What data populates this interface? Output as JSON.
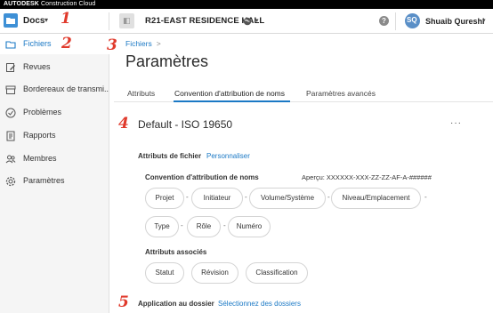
{
  "brand": {
    "bold": "AUTODESK",
    "rest": " Construction Cloud"
  },
  "header": {
    "app_label": "Docs",
    "project_name": "R21-EAST RESIDENCE HALL",
    "help": "?",
    "user_name": "Shuaib Qureshi",
    "user_initials": "SQ"
  },
  "sidebar": {
    "items": [
      {
        "label": "Fichiers",
        "icon": "folder-icon",
        "active": true
      },
      {
        "label": "Revues",
        "icon": "review-icon"
      },
      {
        "label": "Bordereaux de transmi...",
        "icon": "transmittal-icon"
      },
      {
        "label": "Problèmes",
        "icon": "issues-icon"
      },
      {
        "label": "Rapports",
        "icon": "reports-icon"
      },
      {
        "label": "Membres",
        "icon": "members-icon"
      },
      {
        "label": "Paramètres",
        "icon": "settings-icon"
      }
    ]
  },
  "breadcrumb": {
    "item": "Fichiers",
    "sep": ">"
  },
  "page_title": "Paramètres",
  "tabs": [
    {
      "label": "Attributs"
    },
    {
      "label": "Convention d'attribution de noms",
      "active": true
    },
    {
      "label": "Paramètres avancés"
    }
  ],
  "standard": {
    "title": "Default - ISO 19650",
    "more": "···"
  },
  "file_attributes": {
    "label": "Attributs de fichier",
    "link": "Personnaliser"
  },
  "naming": {
    "label": "Convention d'attribution de noms",
    "preview": "Aperçu: XXXXXX-XXX-ZZ-ZZ-AF-A-######",
    "row1": [
      "Projet",
      "Initiateur",
      "Volume/Système",
      "Niveau/Emplacement"
    ],
    "row2": [
      "Type",
      "Rôle",
      "Numéro"
    ],
    "dash": "-"
  },
  "associated": {
    "label": "Attributs associés",
    "items": [
      "Statut",
      "Révision",
      "Classification"
    ]
  },
  "apply": {
    "label": "Application au dossier",
    "link": "Sélectionnez des dossiers"
  },
  "annotations": [
    "1",
    "2",
    "3",
    "4",
    "5"
  ],
  "colors": {
    "accent": "#1b79c5",
    "annotation": "#e03a2c",
    "app_icon": "#3e90d6"
  }
}
